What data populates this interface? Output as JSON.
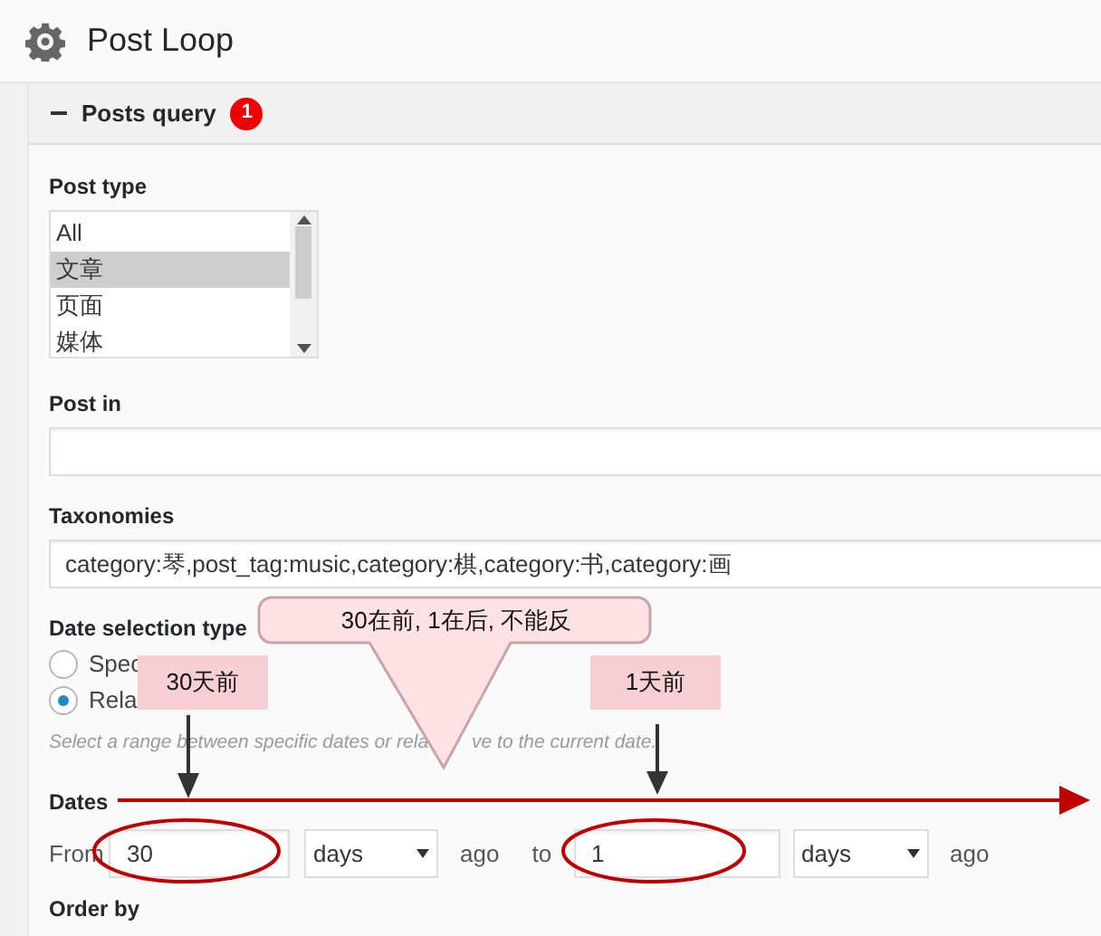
{
  "header": {
    "title": "Post Loop"
  },
  "section": {
    "title": "Posts query",
    "badge": "1",
    "expanded": true
  },
  "post_type": {
    "label": "Post type",
    "options": [
      {
        "label": "All",
        "selected": false
      },
      {
        "label": "文章",
        "selected": true
      },
      {
        "label": "页面",
        "selected": false
      },
      {
        "label": "媒体",
        "selected": false
      }
    ]
  },
  "post_in": {
    "label": "Post in"
  },
  "taxonomies": {
    "label": "Taxonomies",
    "value": "category:琴,post_tag:music,category:棋,category:书,category:画"
  },
  "date_selection": {
    "label": "Date selection type",
    "options": [
      {
        "label": "Spec",
        "selected": false
      },
      {
        "label": "Rela",
        "selected": true
      }
    ],
    "hint_parts": [
      "Select a range between specific dates or rela",
      "ve to the current date."
    ]
  },
  "dates": {
    "label": "Dates",
    "from_label": "From",
    "from_value": "30",
    "from_unit": "days",
    "from_suffix": "ago",
    "to_label": "to",
    "to_value": "1",
    "to_unit": "days",
    "to_suffix": "ago"
  },
  "order_by": {
    "label": "Order by"
  },
  "annotations": {
    "callout": "30在前, 1在后, 不能反",
    "from_note": "30天前",
    "to_note": "1天前"
  }
}
